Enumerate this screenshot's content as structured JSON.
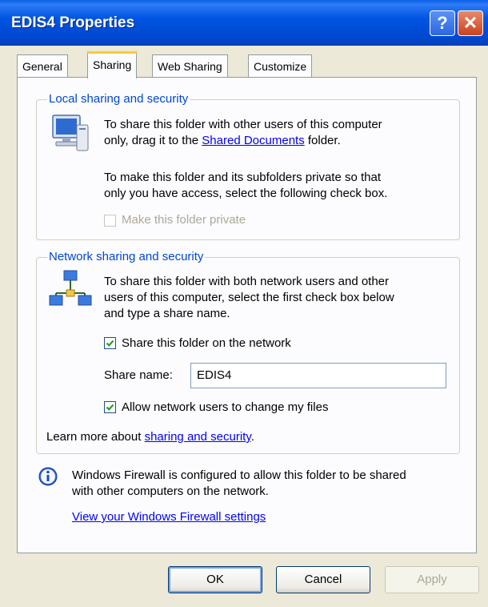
{
  "window": {
    "title": "EDIS4 Properties",
    "help_label": "?",
    "close_label": "✕"
  },
  "tabs": [
    "General",
    "Sharing",
    "Web Sharing",
    "Customize"
  ],
  "local": {
    "legend": "Local sharing and security",
    "line1": "To share this folder with other users of this computer",
    "line2_prefix": "only, drag it to the ",
    "line2_link": "Shared Documents",
    "line2_suffix": " folder.",
    "private_line1": "To make this folder and its subfolders private so that",
    "private_line2": "only you have access, select the following check box.",
    "private_checkbox_label": "Make this folder private",
    "private_checked": false,
    "private_enabled": false
  },
  "network": {
    "legend": "Network sharing and security",
    "line1": "To share this folder with both network users and other",
    "line2": "users of this computer, select the first check box below",
    "line3": "and type a share name.",
    "share_checkbox_label": "Share this folder on the network",
    "share_checked": true,
    "share_name_label": "Share name:",
    "share_name_value": "EDIS4",
    "allow_change_label": "Allow network users to change my files",
    "allow_change_checked": true,
    "learn_more_prefix": "Learn more about ",
    "learn_more_link": "sharing and security",
    "learn_more_suffix": "."
  },
  "firewall": {
    "line1": "Windows Firewall is configured to allow this folder to be shared",
    "line2": "with other computers on the network.",
    "link": "View your Windows Firewall settings"
  },
  "buttons": {
    "ok": "OK",
    "cancel": "Cancel",
    "apply": "Apply"
  },
  "colors": {
    "titlebar": "#0055E3",
    "group_legend": "#0046D5",
    "link": "#0000FF",
    "tab_highlight": "#FFC83C"
  }
}
